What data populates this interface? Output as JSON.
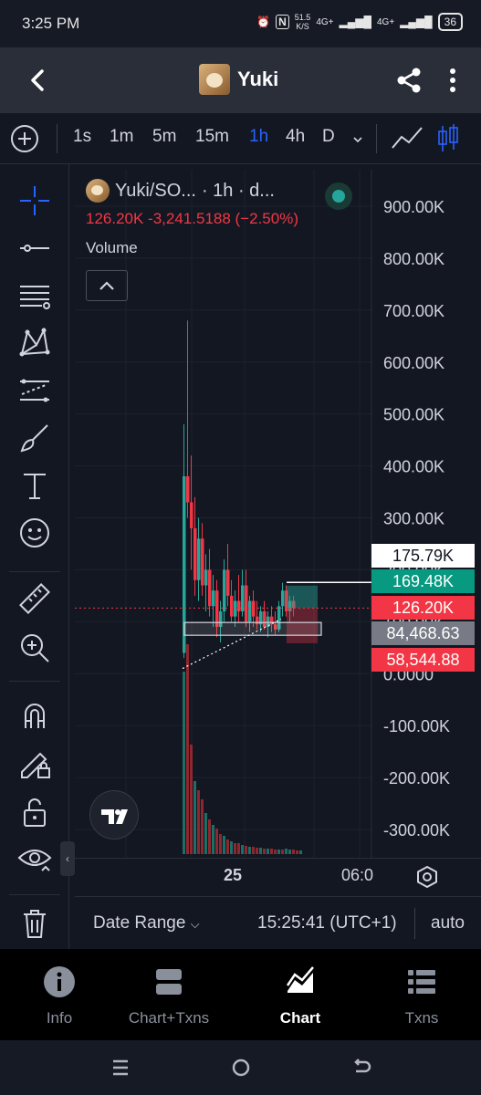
{
  "status_bar": {
    "time": "3:25 PM",
    "net_speed": "51.5",
    "net_unit": "K/S",
    "signal1": "4G+",
    "signal2": "4G+",
    "battery": "36"
  },
  "app_bar": {
    "title": "Yuki",
    "icons": [
      "back-arrow-icon",
      "token-avatar",
      "share-icon",
      "more-vert-icon"
    ]
  },
  "timeframes": {
    "items": [
      "1s",
      "1m",
      "5m",
      "15m",
      "1h",
      "4h",
      "D"
    ],
    "active": "1h"
  },
  "legend": {
    "symbol": "Yuki/SO...",
    "interval": "· 1h · d...",
    "price_line": "126.20K -3,241.5188 (−2.50%)",
    "indicator": "Volume"
  },
  "price_axis": {
    "ticks": [
      "900.00K",
      "800.00K",
      "700.00K",
      "600.00K",
      "500.00K",
      "400.00K",
      "300.00K",
      "200.00K",
      "100.00K",
      "0.0000",
      "-100.00K",
      "-200.00K",
      "-300.00K"
    ]
  },
  "price_labels": [
    {
      "text": "175.79K",
      "bg": "#ffffff",
      "fg": "#131722"
    },
    {
      "text": "169.48K",
      "bg": "#089981",
      "fg": "#ffffff"
    },
    {
      "text": "126.20K",
      "bg": "#f23645",
      "fg": "#ffffff"
    },
    {
      "text": "84,468.63",
      "bg": "#787b86",
      "fg": "#ffffff"
    },
    {
      "text": "58,544.88",
      "bg": "#f23645",
      "fg": "#ffffff"
    }
  ],
  "time_axis": {
    "labels": [
      "25",
      "06:0"
    ]
  },
  "range_bar": {
    "date_range": "Date Range",
    "clock": "15:25:41 (UTC+1)",
    "scale": "auto"
  },
  "bottom_nav": [
    {
      "label": "Info",
      "icon": "info-icon",
      "active": false
    },
    {
      "label": "Chart+Txns",
      "icon": "split-view-icon",
      "active": false
    },
    {
      "label": "Chart",
      "icon": "chart-area-icon",
      "active": true
    },
    {
      "label": "Txns",
      "icon": "list-icon",
      "active": false
    }
  ],
  "colors": {
    "up": "#26a69a",
    "down": "#f23645",
    "accent": "#2962ff",
    "background": "#131722"
  },
  "chart_data": {
    "type": "candlestick",
    "y_range": [
      -300000,
      900000
    ],
    "last_price": 126200,
    "change": -3241.5188,
    "change_pct": -2.5,
    "levels": [
      175790,
      169480,
      126200,
      84468.63,
      58544.88
    ],
    "x_labels": [
      "25",
      "06:0"
    ],
    "volume_shown": true
  }
}
